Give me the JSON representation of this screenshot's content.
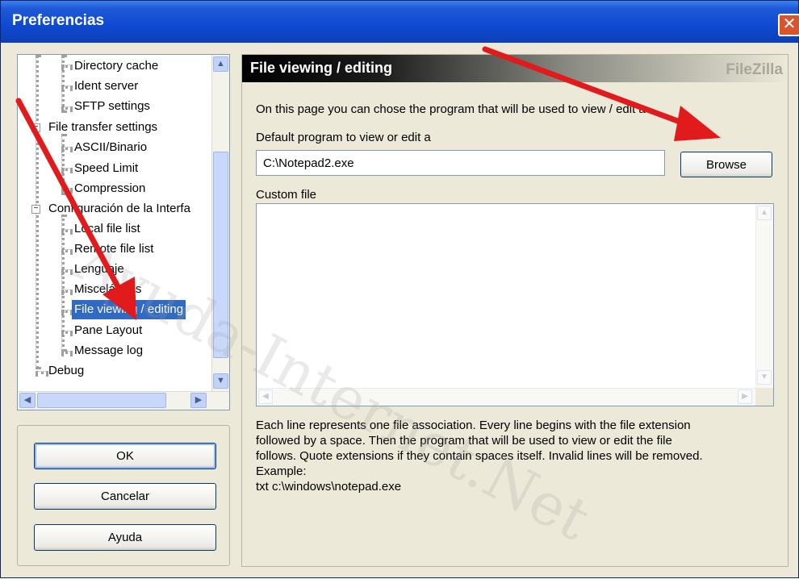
{
  "window": {
    "title": "Preferencias",
    "close_glyph": "✕"
  },
  "tree": {
    "items": [
      {
        "label": "Directory cache"
      },
      {
        "label": "Ident server"
      },
      {
        "label": "SFTP settings"
      },
      {
        "label": "File transfer settings"
      },
      {
        "label": "ASCII/Binario"
      },
      {
        "label": "Speed Limit"
      },
      {
        "label": "Compression"
      },
      {
        "label": "Configuración de la Interfa"
      },
      {
        "label": "Local file list"
      },
      {
        "label": "Remote file list"
      },
      {
        "label": "Lenguaje"
      },
      {
        "label": "Misceláneas"
      },
      {
        "label": "File viewing / editing",
        "selected": true
      },
      {
        "label": "Pane Layout"
      },
      {
        "label": "Message log"
      },
      {
        "label": "Debug"
      }
    ],
    "collapse_glyph": "−"
  },
  "buttons": {
    "ok": "OK",
    "cancel": "Cancelar",
    "help": "Ayuda"
  },
  "page": {
    "title": "File viewing / editing",
    "brand": "FileZilla",
    "intro": "On this page you can chose the program that will be used to view / edit a",
    "default_label": "Default program to view or edit a",
    "default_value": "C:\\Notepad2.exe",
    "browse": "Browse",
    "custom_label": "Custom file",
    "custom_value": "",
    "help_lines": [
      "Each line represents one file association. Every line begins with the file extension",
      "followed by a space. Then the program that will be used to view or edit the file",
      "follows. Quote extensions if they contain spaces itself. Invalid lines will be removed.",
      "Example:",
      "txt c:\\windows\\notepad.exe"
    ]
  },
  "watermark": "Ayuda-Internet.Net",
  "colors": {
    "titlebar": "#0f49d1",
    "selection": "#316ac5",
    "annotation_arrow": "#e11b1b"
  }
}
